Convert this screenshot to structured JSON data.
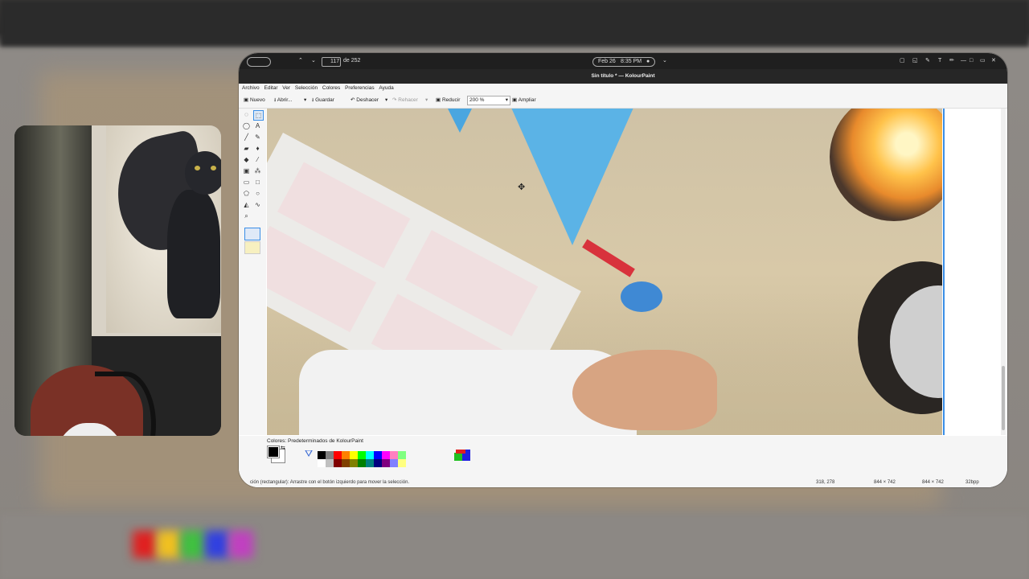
{
  "systray": {
    "page_current": "117",
    "page_total": "de 252",
    "date": "Feb 26",
    "time": "8:35 PM"
  },
  "window": {
    "title": "Sin título * — KolourPaint"
  },
  "menu": [
    "Archivo",
    "Editar",
    "Ver",
    "Selección",
    "Colores",
    "Preferencias",
    "Ayuda"
  ],
  "toolbar": {
    "new_label": "Nuevo",
    "open_label": "Abrir...",
    "save_label": "Guardar",
    "undo_label": "Deshacer",
    "redo_label": "Rehacer",
    "zoom_out_label": "Reducir",
    "zoom_value": "200 %",
    "zoom_in_label": "Ampliar"
  },
  "palette": {
    "label": "Colores: Predeterminados de KolourPaint",
    "foreground": "#000000",
    "background": "#ffffff",
    "row1": [
      "#000000",
      "#808080",
      "#ff0000",
      "#ff8000",
      "#ffff00",
      "#00ff00",
      "#00ffff",
      "#0000ff",
      "#ff00ff",
      "#ff80c0",
      "#80ff80"
    ],
    "row2": [
      "#ffffff",
      "#c0c0c0",
      "#800000",
      "#804000",
      "#808000",
      "#008000",
      "#008080",
      "#000080",
      "#800080",
      "#8080ff",
      "#ffff80"
    ]
  },
  "status": {
    "message": "ción (rectangular): Arrastre con el botón izquierdo para mover la selección.",
    "coords": "318, 278",
    "selection_size": "844 × 742",
    "image_size": "844 × 742",
    "depth": "32bpp"
  }
}
